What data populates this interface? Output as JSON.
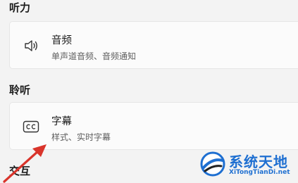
{
  "sections": {
    "hearing": {
      "title": "听力",
      "items": [
        {
          "title": "音频",
          "subtitle": "单声道音频、音频通知",
          "icon": "speaker-icon"
        }
      ]
    },
    "captions_section": {
      "title": "聆听",
      "items": [
        {
          "title": "字幕",
          "subtitle": "样式、实时字幕",
          "icon": "cc-icon"
        }
      ]
    },
    "interaction": {
      "title": "交互"
    }
  },
  "watermark": {
    "text": "系统天地",
    "url": "XiTongTianDi.net"
  },
  "colors": {
    "background": "#f3f3f3",
    "card": "#fbfbfb",
    "annotation_arrow": "#d9342b",
    "watermark": "#1e6fd1"
  }
}
